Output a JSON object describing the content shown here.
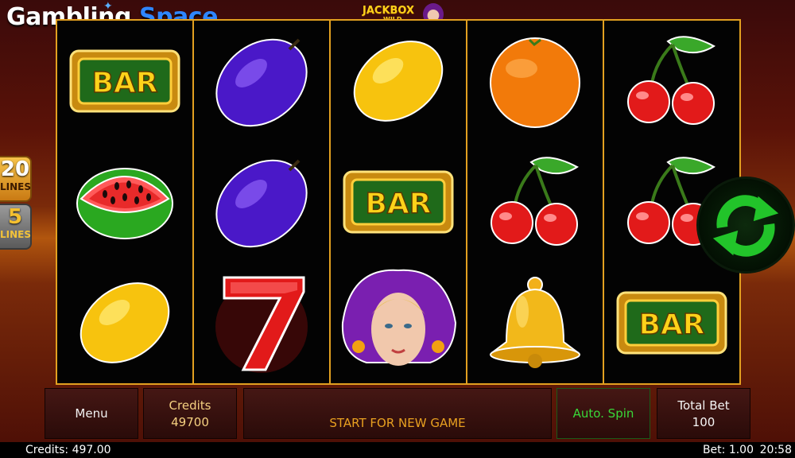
{
  "brand": {
    "word1": "Gambling",
    "word2": "Space"
  },
  "game_logo": {
    "line1": "JACKBOX",
    "line2": "WILD"
  },
  "lines_options": [
    {
      "number": "20",
      "label": "LINES"
    },
    {
      "number": "5",
      "label": "LINES"
    }
  ],
  "reels": [
    [
      "bar",
      "watermelon",
      "lemon"
    ],
    [
      "plum",
      "plum",
      "seven"
    ],
    [
      "lemon",
      "bar",
      "jester-wild"
    ],
    [
      "orange",
      "cherries",
      "bell"
    ],
    [
      "cherries",
      "cherries",
      "bar"
    ]
  ],
  "bar_symbol_text": "BAR",
  "spin_button": {
    "icon": "refresh-arrows-icon",
    "color": "#22c42a"
  },
  "panel": {
    "menu_label": "Menu",
    "credits_label": "Credits",
    "credits_value": "49700",
    "message": "START FOR NEW GAME",
    "auto_spin_label": "Auto. Spin",
    "total_bet_label": "Total Bet",
    "total_bet_value": "100"
  },
  "status": {
    "credits": "Credits: 497.00",
    "bet": "Bet: 1.00",
    "clock": "20:58"
  },
  "colors": {
    "frame": "#e2a020",
    "accent_green": "#39d839",
    "brand_blue": "#2f86ff"
  }
}
